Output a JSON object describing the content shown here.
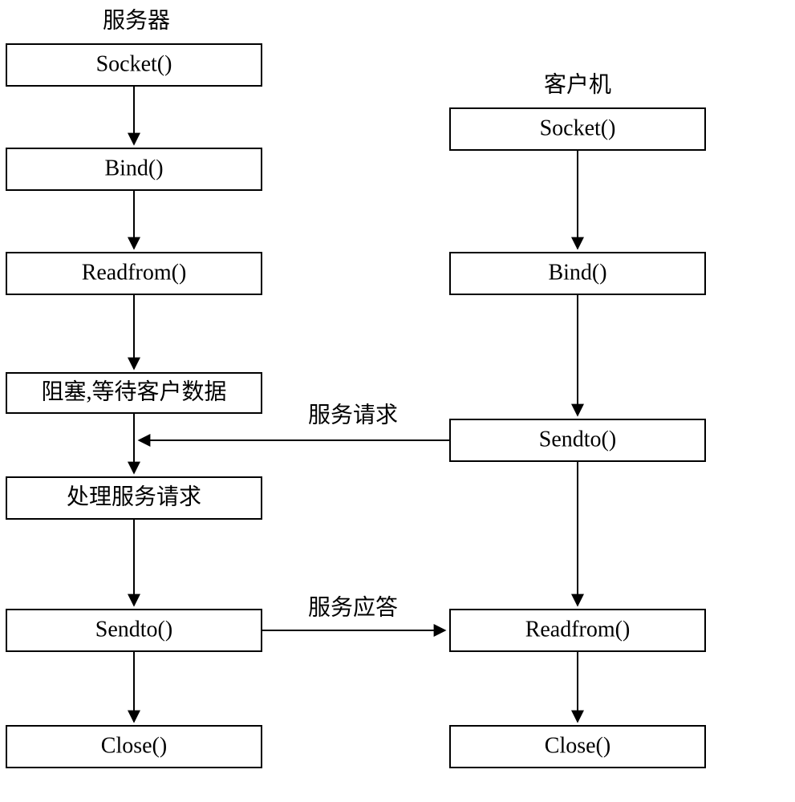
{
  "headers": {
    "server": "服务器",
    "client": "客户机"
  },
  "server": {
    "socket": "Socket()",
    "bind": "Bind()",
    "readfrom": "Readfrom()",
    "block": "阻塞,等待客户数据",
    "process": "处理服务请求",
    "sendto": "Sendto()",
    "close": "Close()"
  },
  "client": {
    "socket": "Socket()",
    "bind": "Bind()",
    "sendto": "Sendto()",
    "readfrom": "Readfrom()",
    "close": "Close()"
  },
  "labels": {
    "request": "服务请求",
    "response": "服务应答"
  }
}
